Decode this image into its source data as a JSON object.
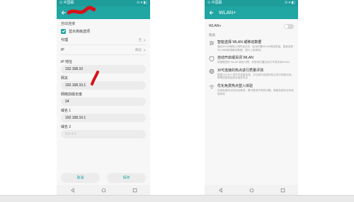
{
  "left_phone": {
    "status_right": "⊙ ▾ ▮▯",
    "status_left": "⊙ 中国联",
    "top_text": "自动连接",
    "auto_connect_label": "显示高级选项",
    "proxy": {
      "label": "代理",
      "value": "无"
    },
    "ip": {
      "label": "IP",
      "value": "静态"
    },
    "fields": [
      {
        "label": "IP 地址",
        "value": "192.168.10"
      },
      {
        "label": "网关",
        "value": "192.168.10.1"
      },
      {
        "label": "网络前缀长度",
        "value": "24"
      },
      {
        "label": "域名 1",
        "value": "192.168.10.1"
      },
      {
        "label": "域名 2",
        "placeholder": "8.8.4.4"
      }
    ],
    "cancel_label": "取消",
    "save_label": "保存"
  },
  "right_phone": {
    "status_left": "⊙ 中国联",
    "status_right": "⊙ ▾ ▮▯",
    "title": "WLAN+",
    "toggle_label": "WLAN+",
    "section_title": "帮助",
    "features": [
      {
        "icon": "sliders-icon",
        "title": "智能选择 WLAN 或移动数据",
        "desc": "通过WLAN网络上网时会优化（自动判断WLAN网络质量，智能选择WLAN网络或移动数据，提升上网体验）"
      },
      {
        "icon": "shield-icon",
        "title": "自动开启或关闭 WLAN",
        "desc": "将根据您的 WLAN 使用习惯，在常用位置自动打开或关闭WLAN"
      },
      {
        "icon": "globe-icon",
        "title": "对可连接的热点进行质量评测",
        "desc": "根据 WLAN+ 的历史质量信息，对当前可连接的热点进行质量评测，帮助您更快选择合适的热点"
      },
      {
        "icon": "wifi-icon",
        "title": "优化免费热点登入体验",
        "desc": "实现免费热点的自动登录，解决登录失败的问题，提高免费热点的连接体验"
      }
    ]
  },
  "colors": {
    "accent": "#20a6a3",
    "scribble": "#d8111a"
  },
  "icons": [
    "back-arrow-icon",
    "check-icon",
    "chevron-right-icon",
    "nav-back-icon",
    "nav-home-icon",
    "nav-recents-icon"
  ]
}
